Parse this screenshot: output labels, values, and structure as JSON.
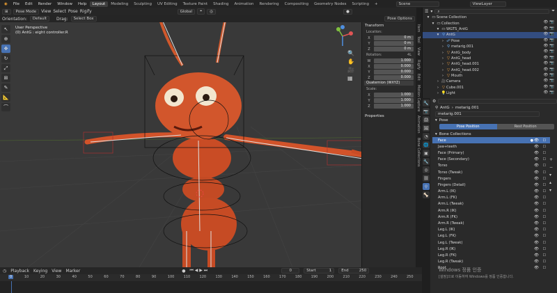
{
  "topbar": {
    "menus": [
      "File",
      "Edit",
      "Render",
      "Window",
      "Help"
    ],
    "workspaces": [
      "Layout",
      "Modeling",
      "Sculpting",
      "UV Editing",
      "Texture Paint",
      "Shading",
      "Animation",
      "Rendering",
      "Compositing",
      "Geometry Nodes",
      "Scripting"
    ],
    "active_workspace": "Layout",
    "scene": "Scene",
    "view_layer": "ViewLayer"
  },
  "viewport_header": {
    "mode": "Pose Mode",
    "menus": [
      "View",
      "Select",
      "Pose",
      "Rigify"
    ],
    "transform": "Global",
    "orientation_label": "Orientation:",
    "orientation": "Default",
    "drag_label": "Drag:",
    "drag": "Select Box",
    "pose_options": "Pose Options"
  },
  "viewport": {
    "title": "User Perspective",
    "subtitle": "(0) AntG : eight controller.R"
  },
  "npanel": {
    "transform_title": "Transform",
    "location_label": "Location:",
    "location": [
      {
        "axis": "X",
        "value": "0 m"
      },
      {
        "axis": "Y",
        "value": "0 m"
      },
      {
        "axis": "Z",
        "value": "0 m"
      }
    ],
    "rotation_label": "Rotation:",
    "rotation_mode_label": "4L",
    "rotation": [
      {
        "axis": "W",
        "value": "1.000"
      },
      {
        "axis": "X",
        "value": "0.000"
      },
      {
        "axis": "Y",
        "value": "0.000"
      },
      {
        "axis": "Z",
        "value": "0.000"
      }
    ],
    "quaternion": "Quaternion (WXYZ)",
    "scale_label": "Scale:",
    "scale": [
      {
        "axis": "X",
        "value": "1.000"
      },
      {
        "axis": "Y",
        "value": "1.000"
      },
      {
        "axis": "Z",
        "value": "1.000"
      }
    ],
    "properties_title": "Properties",
    "tabs": [
      "Item",
      "Tool",
      "View",
      "Rigify",
      "Edit",
      "Motion Capture",
      "Animation",
      "Bone Collections"
    ]
  },
  "timeline": {
    "menus": [
      "Playback",
      "Keying",
      "View",
      "Marker"
    ],
    "current_frame": "0",
    "start_label": "Start",
    "start": "1",
    "end_label": "End",
    "end": "250",
    "ruler": [
      "0",
      "10",
      "20",
      "30",
      "40",
      "50",
      "60",
      "70",
      "80",
      "90",
      "100",
      "110",
      "120",
      "130",
      "140",
      "150",
      "160",
      "170",
      "180",
      "190",
      "200",
      "210",
      "220",
      "230",
      "240",
      "250"
    ],
    "playhead": "0"
  },
  "outliner": {
    "search_placeholder": "",
    "rows": [
      {
        "label": "Scene Collection",
        "indent": 0,
        "icon": "collection-icon"
      },
      {
        "label": "Collection",
        "indent": 1,
        "icon": "collection-icon"
      },
      {
        "label": "WGTS_AntG",
        "indent": 2,
        "icon": "collection-icon"
      },
      {
        "label": "AntG",
        "indent": 2,
        "icon": "armature-icon",
        "selected": true
      },
      {
        "label": "Pose",
        "indent": 3,
        "icon": "pose-icon"
      },
      {
        "label": "metarig.001",
        "indent": 3,
        "icon": "armature-icon"
      },
      {
        "label": "AntG_body",
        "indent": 3,
        "icon": "mesh-icon"
      },
      {
        "label": "AntG_head",
        "indent": 3,
        "icon": "mesh-icon"
      },
      {
        "label": "AntG_head.001",
        "indent": 3,
        "icon": "mesh-icon"
      },
      {
        "label": "AntG_head.002",
        "indent": 3,
        "icon": "mesh-icon"
      },
      {
        "label": "Mouth",
        "indent": 3,
        "icon": "mesh-icon"
      },
      {
        "label": "Camera",
        "indent": 2,
        "icon": "camera-icon"
      },
      {
        "label": "Cube.001",
        "indent": 2,
        "icon": "mesh-icon"
      },
      {
        "label": "Light",
        "indent": 2,
        "icon": "light-icon"
      }
    ]
  },
  "properties": {
    "breadcrumb": [
      "AntG",
      "metarig.001"
    ],
    "armature_name": "metarig.001",
    "pose_title": "Pose",
    "pose_position": "Pose Position",
    "rest_position": "Rest Position",
    "bone_collections_title": "Bone Collections",
    "collections": [
      "Face",
      "Jaw+teeth",
      "Face (Primary)",
      "Face (Secondary)",
      "Torso",
      "Torso (Tweak)",
      "Fingers",
      "Fingers (Detail)",
      "Arm.L (IK)",
      "Arm.L (FK)",
      "Arm.L (Tweak)",
      "Arm.R (IK)",
      "Arm.R (FK)",
      "Arm.R (Tweak)",
      "Leg.L (IK)",
      "Leg.L (FK)",
      "Leg.L (Tweak)",
      "Leg.R (IK)",
      "Leg.R (FK)",
      "Leg.R (Tweak)",
      "Root"
    ],
    "selected_collection": "Face"
  },
  "watermark": {
    "line1": "Windows 정품 인증",
    "line2": "[설정]으로 이동하여 Windows를 정품 인증합니다."
  },
  "colors": {
    "accent": "#4772b3",
    "character": "#d2532a",
    "viewport_bg": "#393939"
  }
}
